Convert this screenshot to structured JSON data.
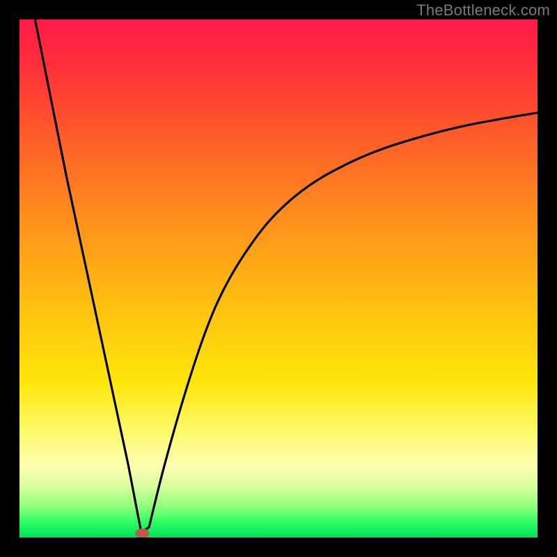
{
  "attribution": "TheBottleneck.com",
  "chart_data": {
    "type": "line",
    "title": "",
    "xlabel": "",
    "ylabel": "",
    "xlim": [
      0,
      100
    ],
    "ylim": [
      0,
      100
    ],
    "series": [
      {
        "name": "left-branch",
        "x": [
          3,
          6,
          9,
          12,
          15,
          18,
          21,
          23.5
        ],
        "values": [
          100,
          85,
          70,
          56,
          42,
          28,
          14,
          1
        ]
      },
      {
        "name": "right-branch",
        "x": [
          25,
          28,
          32,
          36,
          40,
          45,
          50,
          56,
          63,
          70,
          78,
          86,
          94,
          100
        ],
        "values": [
          2,
          14,
          28,
          40,
          49,
          57,
          63,
          68,
          72,
          75,
          77.5,
          79.5,
          81,
          82
        ]
      }
    ],
    "marker": {
      "x": 23.7,
      "y": 0.8,
      "color": "#c05a48"
    },
    "background_gradient": {
      "orientation": "vertical",
      "stops": [
        {
          "pos": 0.0,
          "color": "#ff1a4b"
        },
        {
          "pos": 0.22,
          "color": "#ff5a2a"
        },
        {
          "pos": 0.55,
          "color": "#ffbf10"
        },
        {
          "pos": 0.8,
          "color": "#fff970"
        },
        {
          "pos": 0.94,
          "color": "#8fff7a"
        },
        {
          "pos": 1.0,
          "color": "#00e05a"
        }
      ]
    }
  }
}
